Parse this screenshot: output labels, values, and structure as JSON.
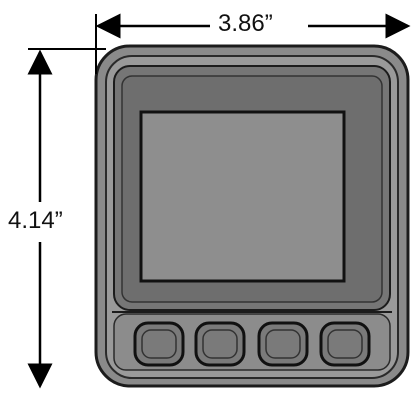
{
  "dimensions": {
    "width": "3.86”",
    "height": "4.14”"
  },
  "device": {
    "button_count": 4
  },
  "colors": {
    "outline": "#1c1c1c",
    "body_outer": "#8a8a8a",
    "body_inner": "#9c9c9c",
    "bezel": "#6e6e6e",
    "screen": "#8e8e8e",
    "button_fill": "#7a7a7a",
    "dimension_line": "#000000"
  }
}
